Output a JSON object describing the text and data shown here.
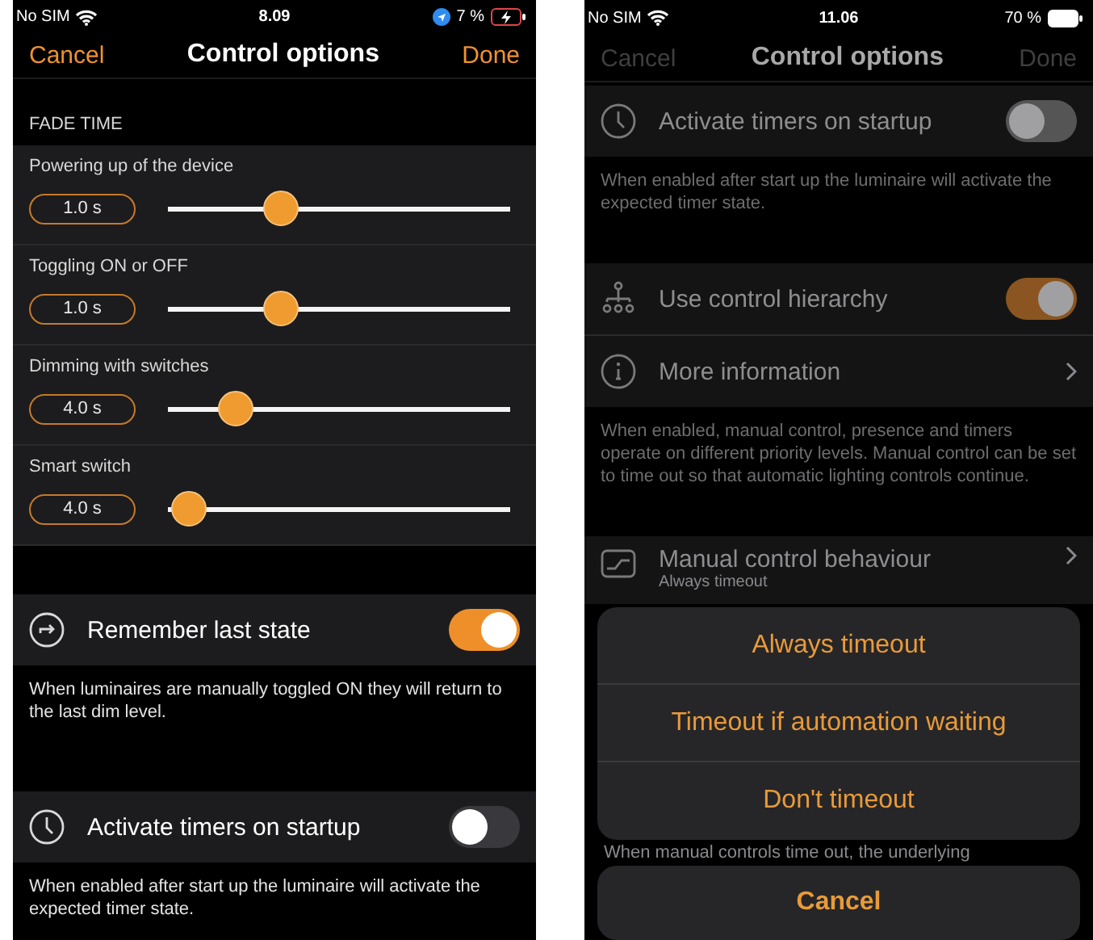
{
  "left_screen": {
    "dimmed": false,
    "status_bar": {
      "carrier": "No SIM",
      "time": "8.09",
      "battery": "7 %",
      "location": true,
      "charging": true
    },
    "nav": {
      "cancel": "Cancel",
      "title": "Control options",
      "done": "Done",
      "buttons_disabled": false
    },
    "section_header": "FADE TIME",
    "sliders": [
      {
        "label": "Powering up of the device",
        "value": "1.0 s",
        "level": 0.33
      },
      {
        "label": "Toggling ON or OFF",
        "value": "1.0 s",
        "level": 0.33
      },
      {
        "label": "Dimming with switches",
        "value": "4.0 s",
        "level": 0.2
      },
      {
        "label": "Smart switch",
        "value": "4.0 s",
        "level": 0.06
      }
    ],
    "groups": [
      {
        "rows": [
          {
            "kind": "toggle",
            "label": "Remember last state",
            "on": true
          }
        ],
        "description": "When luminaires are manually toggled ON they will return to the last dim level."
      },
      {
        "rows": [
          {
            "kind": "toggle",
            "label": "Activate timers on startup",
            "on": false
          }
        ],
        "description": "When enabled after start up the luminaire will activate the expected timer state."
      }
    ]
  },
  "right_screen": {
    "dimmed": true,
    "status_bar": {
      "carrier": "No SIM",
      "time": "11.06",
      "battery": "70 %",
      "location": false,
      "charging": false
    },
    "nav": {
      "cancel": "Cancel",
      "title": "Control options",
      "done": "Done",
      "buttons_disabled": true
    },
    "groups": [
      {
        "rows": [
          {
            "kind": "toggle",
            "label": "Activate timers on startup",
            "on": false
          }
        ],
        "description": "When enabled after start up the luminaire will activate the expected timer state."
      },
      {
        "rows": [
          {
            "kind": "toggle",
            "label": "Use control hierarchy",
            "on": true
          },
          {
            "kind": "link",
            "label": "More information"
          }
        ],
        "description": "When enabled, manual control, presence and timers operate on different priority levels. Manual control can be set to time out so that automatic lighting controls continue."
      },
      {
        "rows": [
          {
            "kind": "link",
            "label": "Manual control behaviour",
            "subtitle": "Always timeout"
          }
        ]
      }
    ],
    "action_sheet": {
      "options": [
        "Always timeout",
        "Timeout if automation waiting",
        "Don't timeout"
      ],
      "note": "When manual controls time out, the underlying",
      "cancel": "Cancel"
    }
  }
}
